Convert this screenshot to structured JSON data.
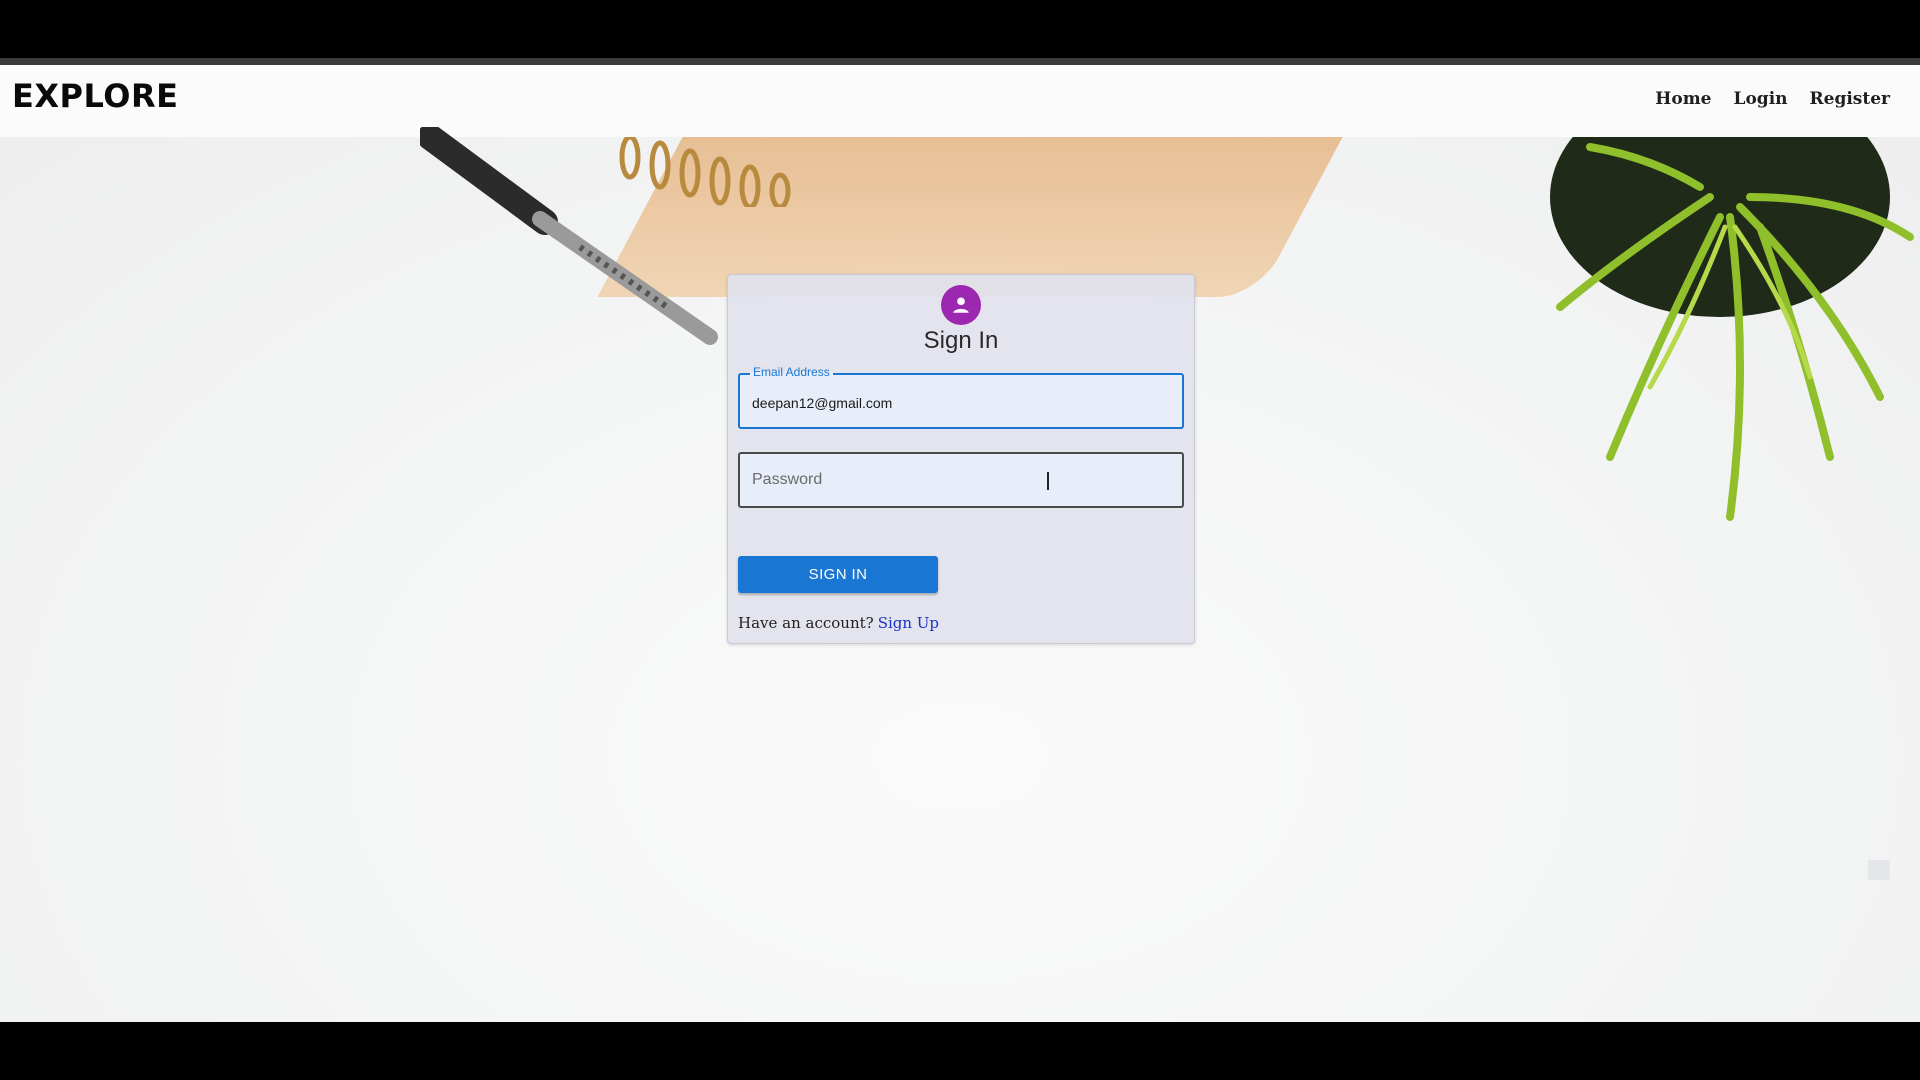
{
  "brand": "EXPLORE",
  "nav": {
    "home": "Home",
    "login": "Login",
    "register": "Register"
  },
  "signin": {
    "avatar_icon": "person-icon",
    "title": "Sign In",
    "email_label": "Email Address",
    "email_value": "deepan12@gmail.com",
    "password_placeholder": "Password",
    "password_value": "",
    "button": "SIGN IN",
    "have_account": "Have an account?",
    "signup_link": "Sign Up"
  },
  "colors": {
    "primary": "#1976d2",
    "avatar": "#9c27b0",
    "link": "#1b30c8"
  }
}
